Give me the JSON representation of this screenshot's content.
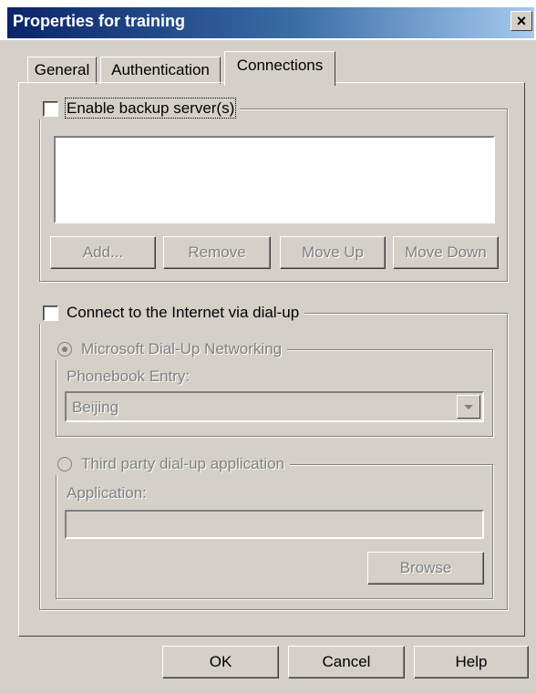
{
  "window": {
    "title": "Properties for training",
    "close_glyph": "×"
  },
  "tabs": [
    {
      "label": "General"
    },
    {
      "label": "Authentication"
    },
    {
      "label": "Connections"
    }
  ],
  "backup": {
    "checkbox_label": "Enable backup server(s)",
    "checked": false,
    "buttons": {
      "add": "Add...",
      "remove": "Remove",
      "move_up": "Move Up",
      "move_down": "Move Down"
    }
  },
  "dialup": {
    "checkbox_label": "Connect to the Internet via dial-up",
    "checked": false,
    "microsoft": {
      "radio_label": "Microsoft Dial-Up Networking",
      "phonebook_label": "Phonebook Entry:",
      "phonebook_value": "Beijing"
    },
    "third_party": {
      "radio_label": "Third party dial-up application",
      "application_label": "Application:",
      "application_value": "",
      "browse_label": "Browse"
    }
  },
  "footer": {
    "ok": "OK",
    "cancel": "Cancel",
    "help": "Help"
  }
}
